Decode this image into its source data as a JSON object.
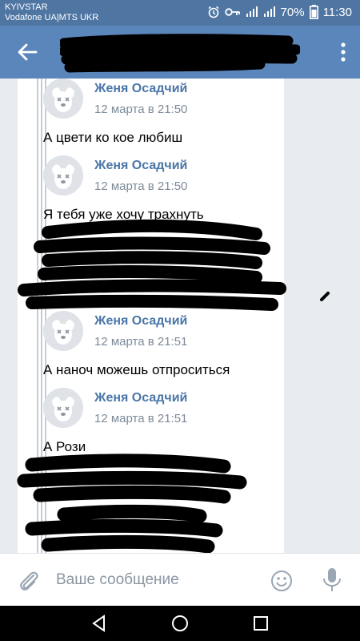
{
  "status_bar": {
    "carrier1": "KYIVSTAR",
    "carrier2": "Vodafone UA|MTS UKR",
    "battery": "70%",
    "time": "11:30"
  },
  "header": {
    "title_redacted": true,
    "back_icon": "arrow-left-icon",
    "menu_icon": "more-vert-icon"
  },
  "messages": [
    {
      "name": "Женя Осадчий",
      "time": "12 марта в 21:50",
      "text": "А цвети ко кое любиш"
    },
    {
      "name": "Женя Осадчий",
      "time": "12 марта в 21:50",
      "text": "Я тебя уже хочу трахнуть"
    },
    {
      "name": "Женя Осадчий",
      "time": "12 марта в 21:51",
      "text": "А наноч можешь отпроситься"
    },
    {
      "name": "Женя Осадчий",
      "time": "12 марта в 21:51",
      "text": "А Рози"
    }
  ],
  "input": {
    "placeholder": "Ваше сообщение"
  },
  "colors": {
    "status_bar": "#4f76a3",
    "app_bar": "#5b86bb",
    "name": "#4a76a8",
    "time": "#7d8b99"
  }
}
